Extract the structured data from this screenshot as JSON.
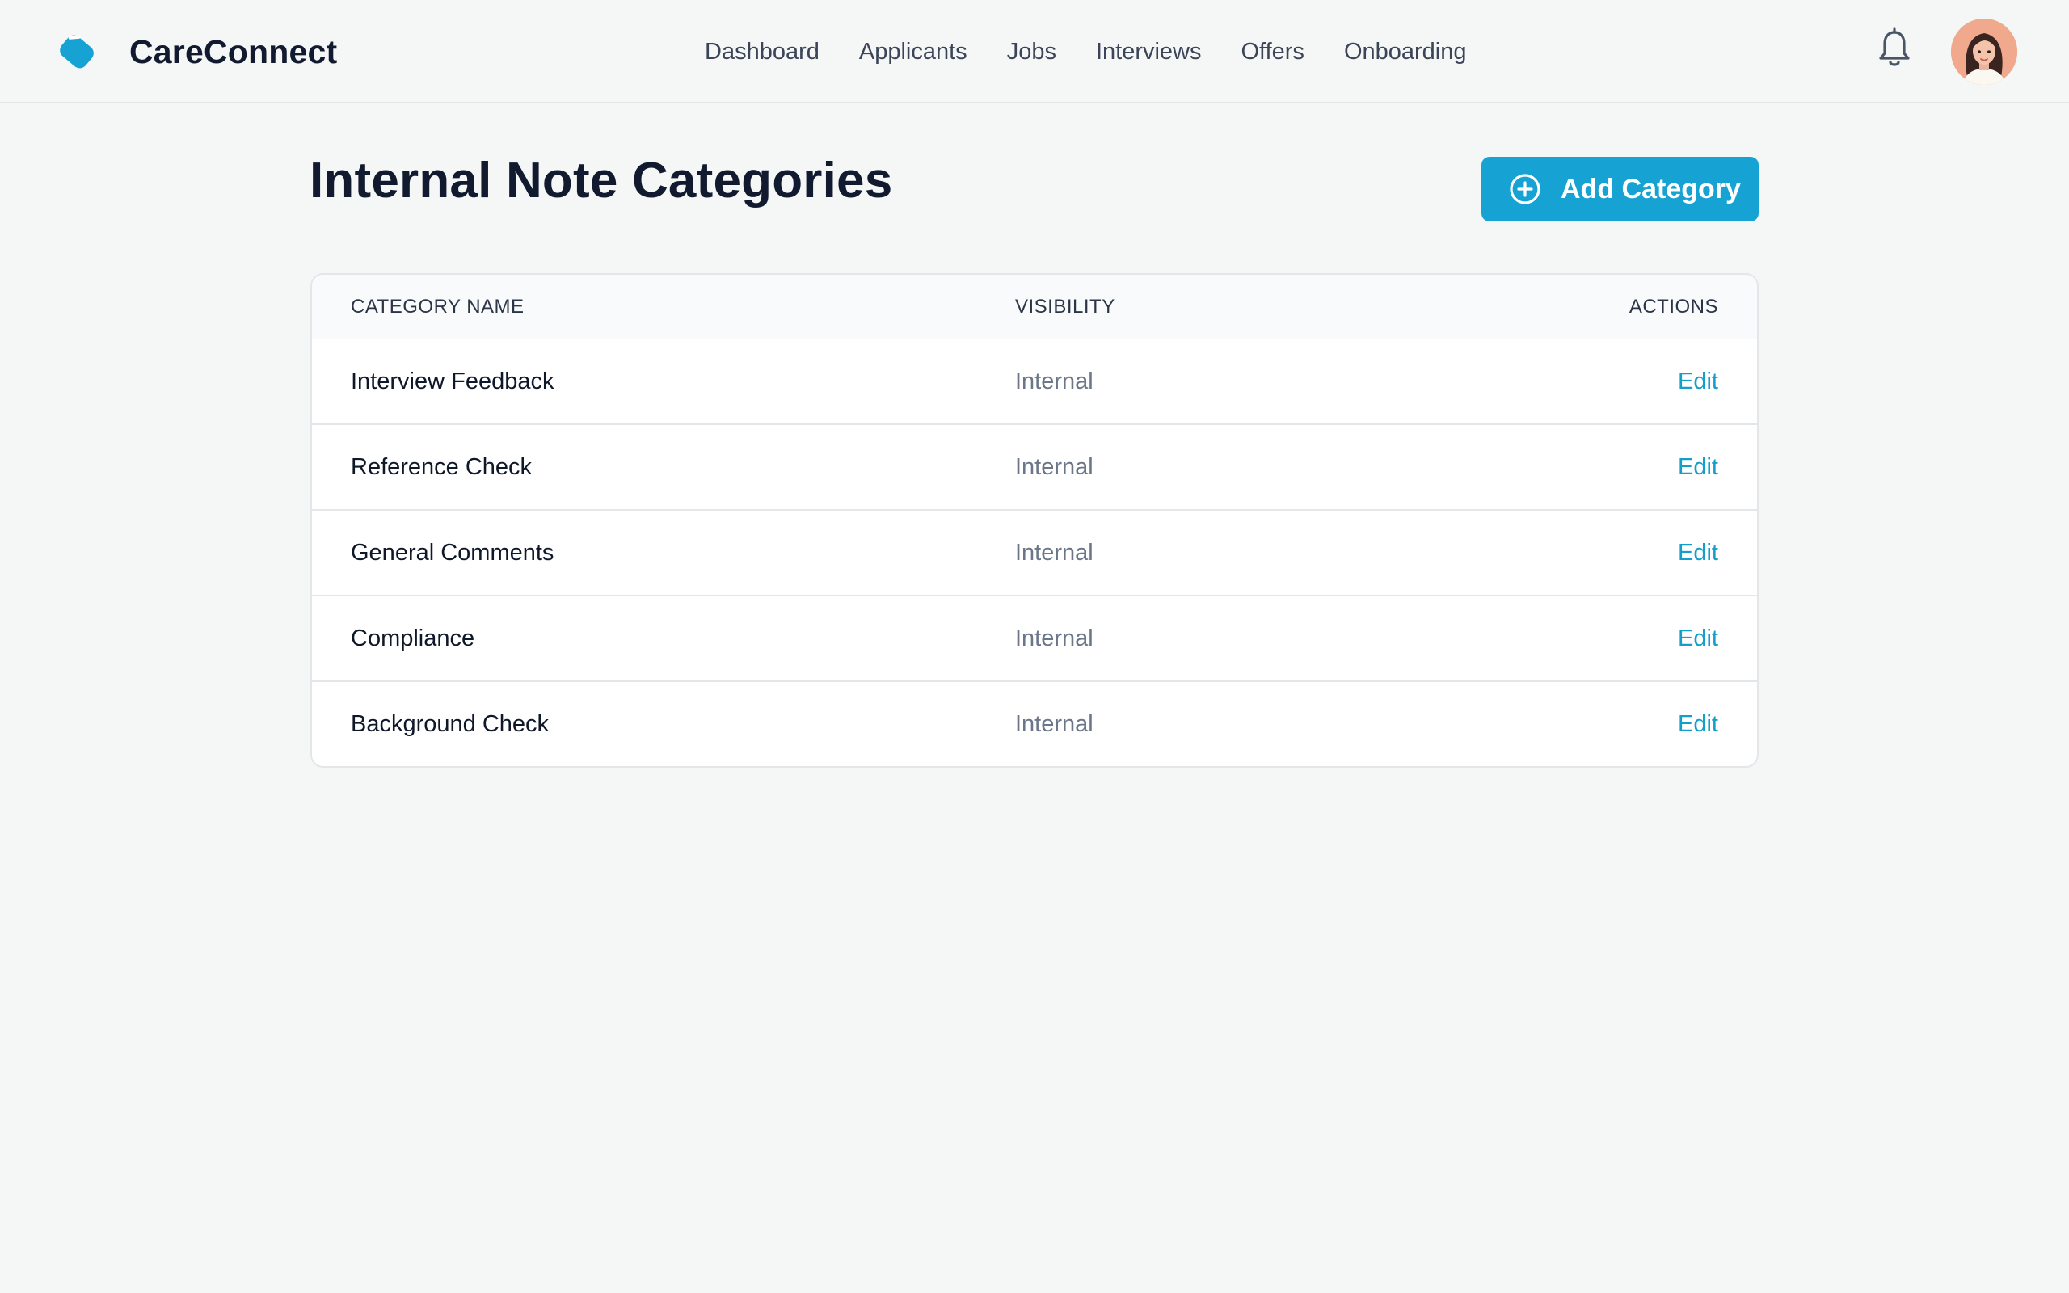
{
  "brand": {
    "name": "CareConnect",
    "logo_icon": "tag-icon",
    "accent_color": "#16a3d4"
  },
  "nav": {
    "items": [
      {
        "label": "Dashboard"
      },
      {
        "label": "Applicants"
      },
      {
        "label": "Jobs"
      },
      {
        "label": "Interviews"
      },
      {
        "label": "Offers"
      },
      {
        "label": "Onboarding"
      }
    ],
    "notification_icon": "bell-icon",
    "avatar_icon": "user-avatar"
  },
  "page": {
    "title": "Internal Note Categories",
    "add_button_label": "Add Category",
    "add_button_icon": "plus-circle-icon"
  },
  "table": {
    "headers": {
      "name": "CATEGORY NAME",
      "visibility": "VISIBILITY",
      "actions": "ACTIONS"
    },
    "rows": [
      {
        "name": "Interview Feedback",
        "visibility": "Internal",
        "action": "Edit"
      },
      {
        "name": "Reference Check",
        "visibility": "Internal",
        "action": "Edit"
      },
      {
        "name": "General Comments",
        "visibility": "Internal",
        "action": "Edit"
      },
      {
        "name": "Compliance",
        "visibility": "Internal",
        "action": "Edit"
      },
      {
        "name": "Background Check",
        "visibility": "Internal",
        "action": "Edit"
      }
    ],
    "link_color": "#159ec9"
  }
}
